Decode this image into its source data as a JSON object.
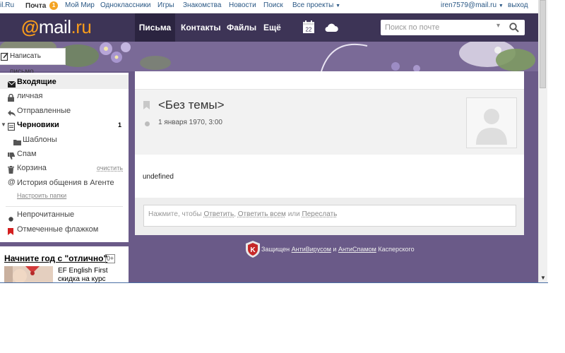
{
  "portal": {
    "links": [
      "il.Ru",
      "Почта",
      "Мой Мир",
      "Одноклассники",
      "Игры",
      "Знакомства",
      "Новости",
      "Поиск",
      "Все проекты"
    ],
    "mail_badge": "1",
    "user_email": "iren7579@mail.ru",
    "logout": "выход"
  },
  "header": {
    "logo": {
      "at": "@",
      "mail": "mail",
      "ru": ".ru"
    },
    "tabs": [
      "Письма",
      "Контакты",
      "Файлы",
      "Ещё"
    ],
    "calendar_day": "22",
    "search_placeholder": "Поиск по почте"
  },
  "compose_label": "Написать письмо",
  "sidebar": {
    "folders": [
      {
        "label": "Входящие",
        "icon": "envelope-icon",
        "bold": true,
        "selected": true
      },
      {
        "label": "личная",
        "icon": "lock-icon"
      },
      {
        "label": "Отправленные",
        "icon": "reply-arrow-icon"
      },
      {
        "label": "Черновики",
        "icon": "draft-icon",
        "bold": true,
        "count": "1"
      },
      {
        "label": "Шаблоны",
        "icon": "folder-icon"
      },
      {
        "label": "Спам",
        "icon": "thumbs-down-icon"
      },
      {
        "label": "Корзина",
        "icon": "trash-icon",
        "action": "очистить"
      },
      {
        "label": "История общения в Агенте",
        "icon": "at-icon"
      }
    ],
    "setup_link": "Настроить папки",
    "filters": [
      {
        "label": "Непрочитанные",
        "icon": "dot-icon"
      },
      {
        "label": "Отмеченные флажком",
        "icon": "flag-icon"
      }
    ]
  },
  "promo": {
    "title": "Начните год с \"отлично\"",
    "age": "0+",
    "line1": "EF English First",
    "line2": "скидка на курс"
  },
  "message": {
    "subject": "<Без темы>",
    "date": "1 января 1970, 3:00",
    "body": "undefined",
    "reply_prefix": "Нажмите, чтобы ",
    "reply_link": "Ответить",
    "reply_all_link": "Ответить всем",
    "or": " или ",
    "forward_link": "Переслать"
  },
  "kaspersky": {
    "prefix": "Защищен ",
    "antivirus": "АнтиВирусом",
    "and": " и ",
    "antispam": "АнтиСпамом",
    "suffix": " Касперского"
  },
  "colors": {
    "header_bg": "#3d3456",
    "accent_orange": "#f89c1c",
    "background_purple": "#6a5a88",
    "link_blue": "#2a5885"
  }
}
